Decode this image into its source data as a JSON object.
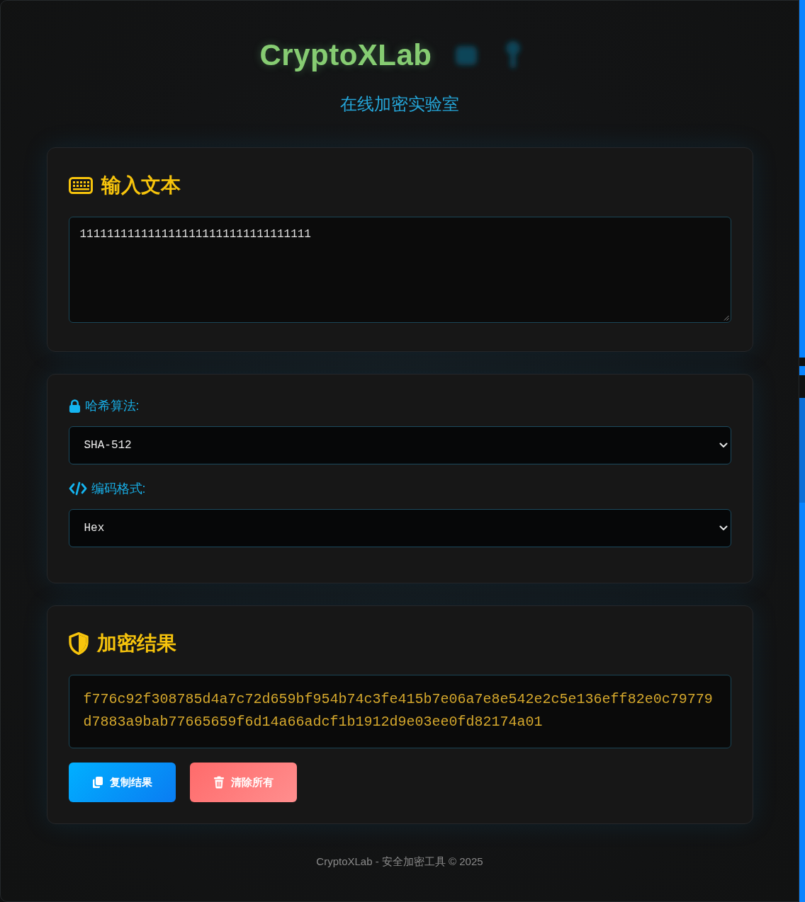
{
  "header": {
    "title": "CryptoXLab",
    "subtitle": "在线加密实验室"
  },
  "input_card": {
    "heading": "输入文本",
    "text": "1111111111111111111111111111111111"
  },
  "settings_card": {
    "fields": [
      {
        "label": "哈希算法:",
        "value": "SHA-512"
      },
      {
        "label": "编码格式:",
        "value": "Hex"
      }
    ]
  },
  "result_card": {
    "heading": "加密结果",
    "output": "f776c92f308785d4a7c72d659bf954b74c3fe415b7e06a7e8e542e2c5e136eff82e0c79779d7883a9bab77665659f6d14a66adcf1b1912d9e03ee0fd82174a01",
    "buttons": [
      {
        "label": "复制结果",
        "kind": "primary"
      },
      {
        "label": "清除所有",
        "kind": "danger"
      }
    ]
  },
  "footer": {
    "text": "CryptoXLab - 安全加密工具 © 2025"
  }
}
